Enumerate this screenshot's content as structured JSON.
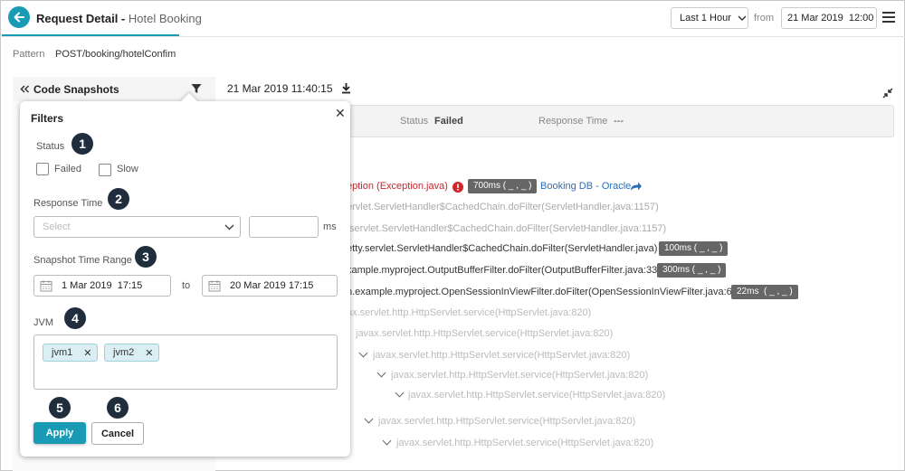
{
  "header": {
    "title": "Request Detail",
    "title_separator": " - ",
    "subtitle": "Hotel Booking",
    "time_range": "Last 1 Hour",
    "from_label": "from",
    "from_value": "21 Mar 2019  12:00"
  },
  "pattern": {
    "label": "Pattern",
    "value": "POST/booking/hotelConfim"
  },
  "snapshots": {
    "title": "Code Snapshots"
  },
  "detail": {
    "timestamp": "21 Mar 2019 11:40:15",
    "status_label": "Status",
    "status_value": "Failed",
    "response_time_label": "Response Time",
    "response_time_value": "---"
  },
  "trace": [
    {
      "text": "eption (Exception.java)",
      "badge": "700ms ( _ , _ )",
      "link": "Booking DB - Oracle"
    },
    {
      "text": "ervlet.ServletHandler$CachedChain.doFilter(ServletHandler.java:1157)"
    },
    {
      "text": ".servlet.ServletHandler$CachedChain.doFilter(ServletHandler.java:1157)"
    },
    {
      "text": "etty.servlet.ServletHandler$CachedChain.doFilter(ServletHandler.java)",
      "badge": "100ms ( _ , _ )"
    },
    {
      "text": "xample.myproject.OutputBufferFilter.doFilter(OutputBufferFilter.java:33)",
      "badge": "300ms ( _ , _ )"
    },
    {
      "text": "n.example.myproject.OpenSessionInViewFilter.doFilter(OpenSessionInViewFilter.java:60)",
      "badge": "22ms  ( _ , _ )"
    },
    {
      "text": "ax.servlet.http.HttpServlet.service(HttpServlet.java:820)"
    },
    {
      "text": "javax.servlet.http.HttpServlet.service(HttpServlet.java:820)"
    },
    {
      "text": "javax.servlet.http.HttpServlet.service(HttpServlet.java:820)"
    },
    {
      "text": "javax.servlet.http.HttpServlet.service(HttpServlet.java:820)"
    },
    {
      "text": "javax.servlet.http.HttpServlet.service(HttpServlet.java:820)"
    },
    {
      "text": "javax.servlet.http.HttpServlet.service(HttpServlet.java:820)"
    },
    {
      "text": "javax.servlet.http.HttpServlet.service(HttpServlet.java:820)"
    }
  ],
  "filters": {
    "title": "Filters",
    "status_label": "Status",
    "status_step": "1",
    "failed_label": "Failed",
    "slow_label": "Slow",
    "response_time_label": "Response Time",
    "response_time_step": "2",
    "select_placeholder": "Select",
    "ms_label": "ms",
    "range_label": "Snapshot Time Range",
    "range_step": "3",
    "range_from": "1 Mar 2019  17:15",
    "to_label": "to",
    "range_to": "20 Mar 2019 17:15",
    "jvm_label": "JVM",
    "jvm_step": "4",
    "jvm_tags": [
      "jvm1",
      "jvm2"
    ],
    "apply_step": "5",
    "apply_label": "Apply",
    "cancel_step": "6",
    "cancel_label": "Cancel"
  },
  "colors": {
    "accent": "#1a9bb5",
    "step_badge": "#1f2d3d",
    "link": "#2a6ebb",
    "error": "#d0262d"
  }
}
